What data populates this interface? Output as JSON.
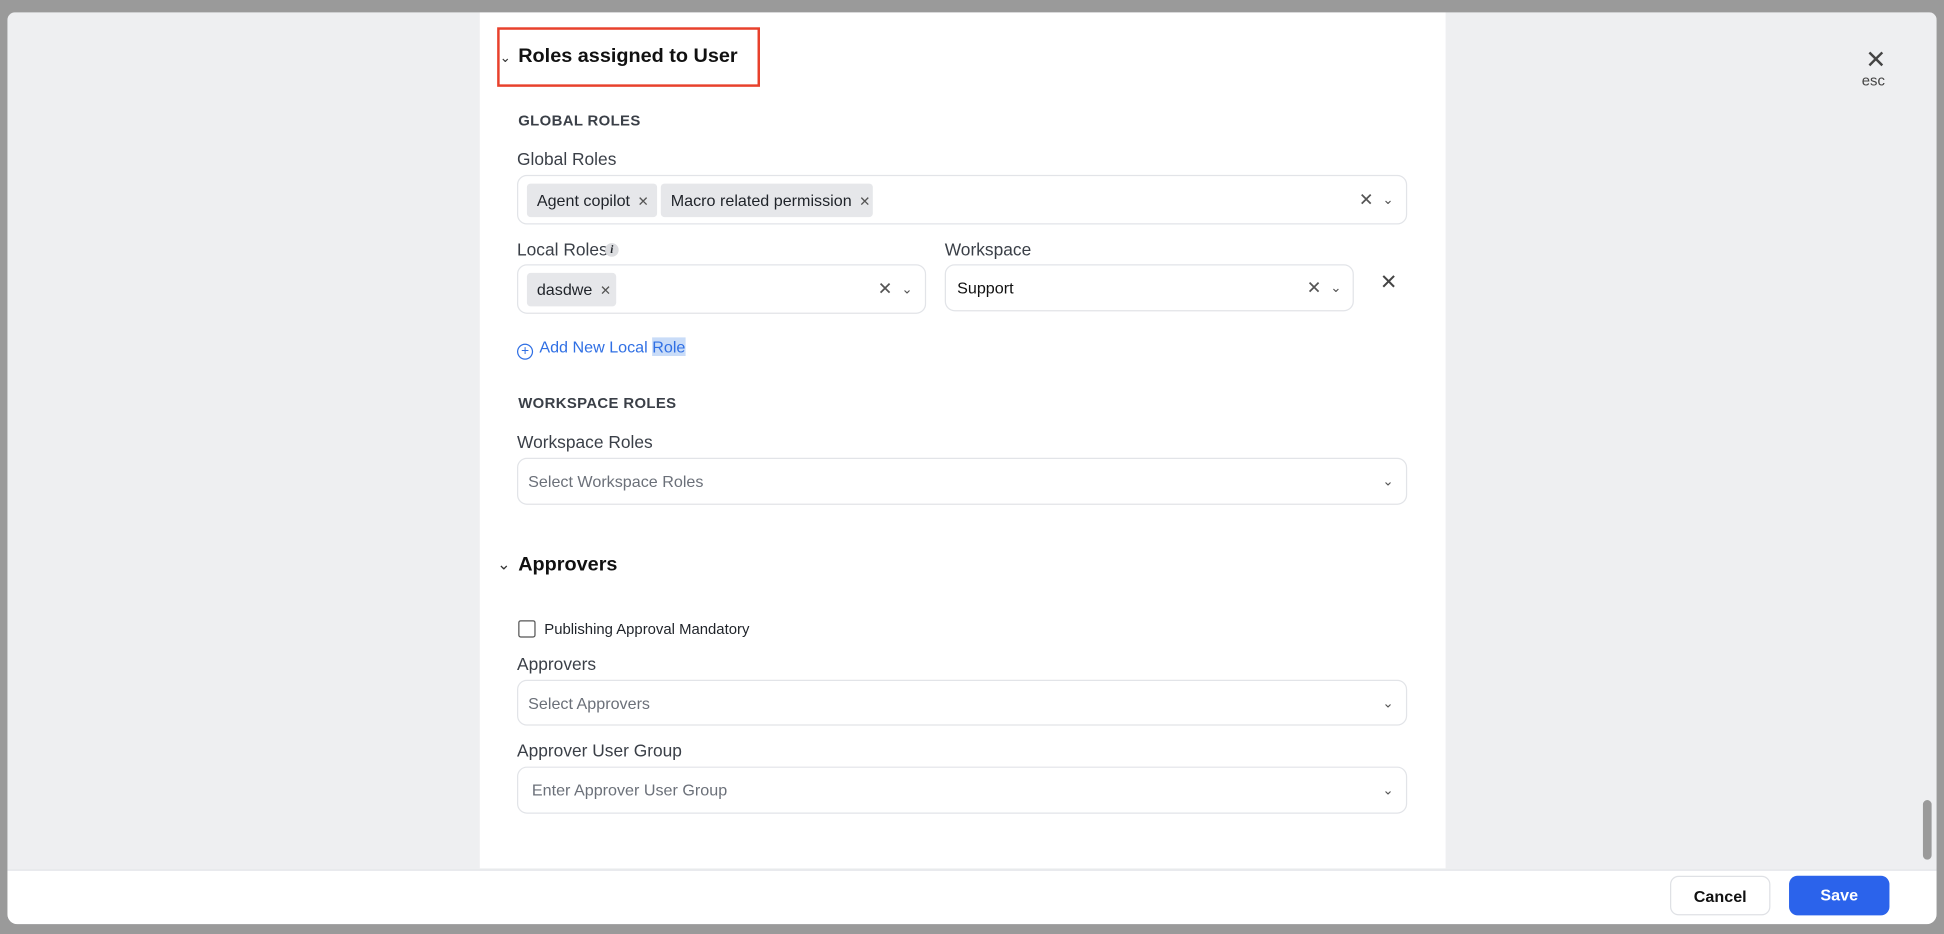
{
  "close": {
    "icon": "close-icon",
    "hint": "esc"
  },
  "roles_section": {
    "title": "Roles assigned to User",
    "global_heading": "GLOBAL ROLES",
    "global_label": "Global Roles",
    "global_chips": [
      "Agent copilot",
      "Macro related permission"
    ],
    "local_label": "Local Roles",
    "local_chips": [
      "dasdwe"
    ],
    "workspace_label": "Workspace",
    "workspace_value": "Support",
    "add_local_prefix": "Add New Local ",
    "add_local_highlight": "Role",
    "workspace_heading": "WORKSPACE ROLES",
    "workspace_roles_label": "Workspace Roles",
    "workspace_roles_placeholder": "Select Workspace Roles"
  },
  "approvers_section": {
    "title": "Approvers",
    "checkbox_label": "Publishing Approval Mandatory",
    "checkbox_checked": false,
    "approvers_label": "Approvers",
    "approvers_placeholder": "Select Approvers",
    "group_label": "Approver User Group",
    "group_placeholder": "Enter Approver User Group"
  },
  "footer": {
    "cancel": "Cancel",
    "save": "Save"
  },
  "colors": {
    "accent": "#2b63eb",
    "link": "#2f6fe4",
    "highlight_box": "#e8412c"
  }
}
